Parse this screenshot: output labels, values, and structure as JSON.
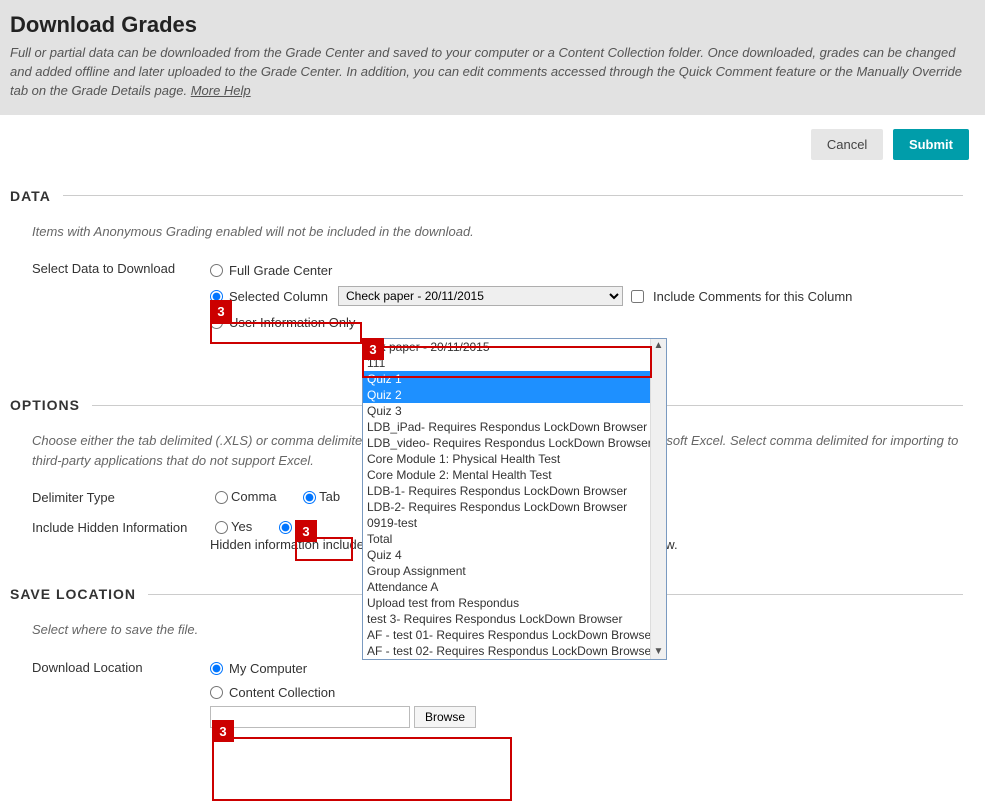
{
  "header": {
    "title": "Download Grades",
    "description": "Full or partial data can be downloaded from the Grade Center and saved to your computer or a Content Collection folder. Once downloaded, grades can be changed and added offline and later uploaded to the Grade Center. In addition, you can edit comments accessed through the Quick Comment feature or the Manually Override tab on the Grade Details page. ",
    "more_help": "More Help"
  },
  "actions": {
    "cancel": "Cancel",
    "submit": "Submit"
  },
  "callout_badge": "3",
  "data_section": {
    "heading": "DATA",
    "note": "Items with Anonymous Grading enabled will not be included in the download.",
    "select_label": "Select Data to Download",
    "opt_full": "Full Grade Center",
    "opt_selected": "Selected Column",
    "opt_user": "User Information Only",
    "select_value": "Check paper - 20/11/2015",
    "include_comments_label": "Include Comments for this Column",
    "dropdown_items": [
      "     eck paper - 20/11/2015",
      "     111",
      "Quiz 1",
      "Quiz 2",
      "Quiz 3",
      "LDB_iPad- Requires Respondus LockDown Browser",
      "LDB_video- Requires Respondus LockDown Browser",
      "Core Module 1: Physical Health Test",
      "Core Module 2: Mental Health Test",
      "LDB-1- Requires Respondus LockDown Browser",
      "LDB-2- Requires Respondus LockDown Browser",
      "0919-test",
      "Total",
      "Quiz 4",
      "Group Assignment",
      "Attendance A",
      "Upload test from Respondus",
      "test 3- Requires Respondus LockDown Browser",
      "AF - test 01- Requires Respondus LockDown Browser",
      "AF - test 02- Requires Respondus LockDown Browser"
    ]
  },
  "options_section": {
    "heading": "OPTIONS",
    "note": "Choose either the tab delimited (.XLS) or comma delimited (.CSV) for use in another application such as Microsoft Excel. Select comma delimited for importing to third-party applications that do not support Excel.",
    "delimiter_label": "Delimiter Type",
    "delimiter_comma": "Comma",
    "delimiter_tab": "Tab",
    "hidden_label": "Include Hidden Information",
    "hidden_yes": "Yes",
    "hidden_no": "No",
    "hidden_note": "Hidden information includes columns and users that have been hidden from view."
  },
  "save_section": {
    "heading": "SAVE LOCATION",
    "note": "Select where to save the file.",
    "download_label": "Download Location",
    "opt_my_computer": "My Computer",
    "opt_content_collection": "Content Collection",
    "browse": "Browse"
  }
}
